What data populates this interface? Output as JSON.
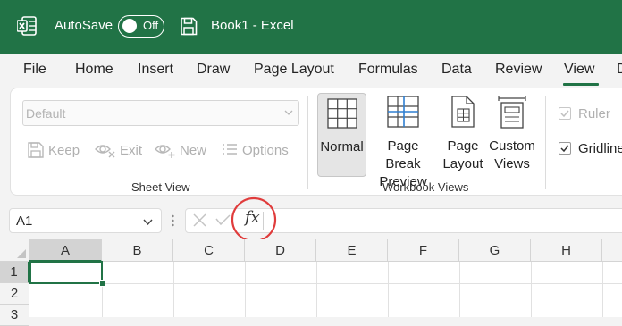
{
  "titlebar": {
    "autosave_label": "AutoSave",
    "autosave_state": "Off",
    "document_title": "Book1  -  Excel",
    "brand_color": "#217346"
  },
  "tabs": [
    "File",
    "Home",
    "Insert",
    "Draw",
    "Page Layout",
    "Formulas",
    "Data",
    "Review",
    "View",
    "D"
  ],
  "active_tab": "View",
  "sheet_view": {
    "dropdown_value": "Default",
    "buttons": [
      "Keep",
      "Exit",
      "New",
      "Options"
    ],
    "group_label": "Sheet View"
  },
  "workbook_views": {
    "normal": "Normal",
    "page_break_line1": "Page Break",
    "page_break_line2": "Preview",
    "page_layout_line1": "Page",
    "page_layout_line2": "Layout",
    "custom_views_line1": "Custom",
    "custom_views_line2": "Views",
    "group_label": "Workbook Views"
  },
  "show": {
    "ruler": "Ruler",
    "gridlines": "Gridlines"
  },
  "formula_bar": {
    "name_box": "A1",
    "fx": "fx"
  },
  "grid": {
    "columns": [
      "A",
      "B",
      "C",
      "D",
      "E",
      "F",
      "G",
      "H"
    ],
    "rows": [
      "1",
      "2",
      "3"
    ],
    "active_cell": "A1"
  }
}
